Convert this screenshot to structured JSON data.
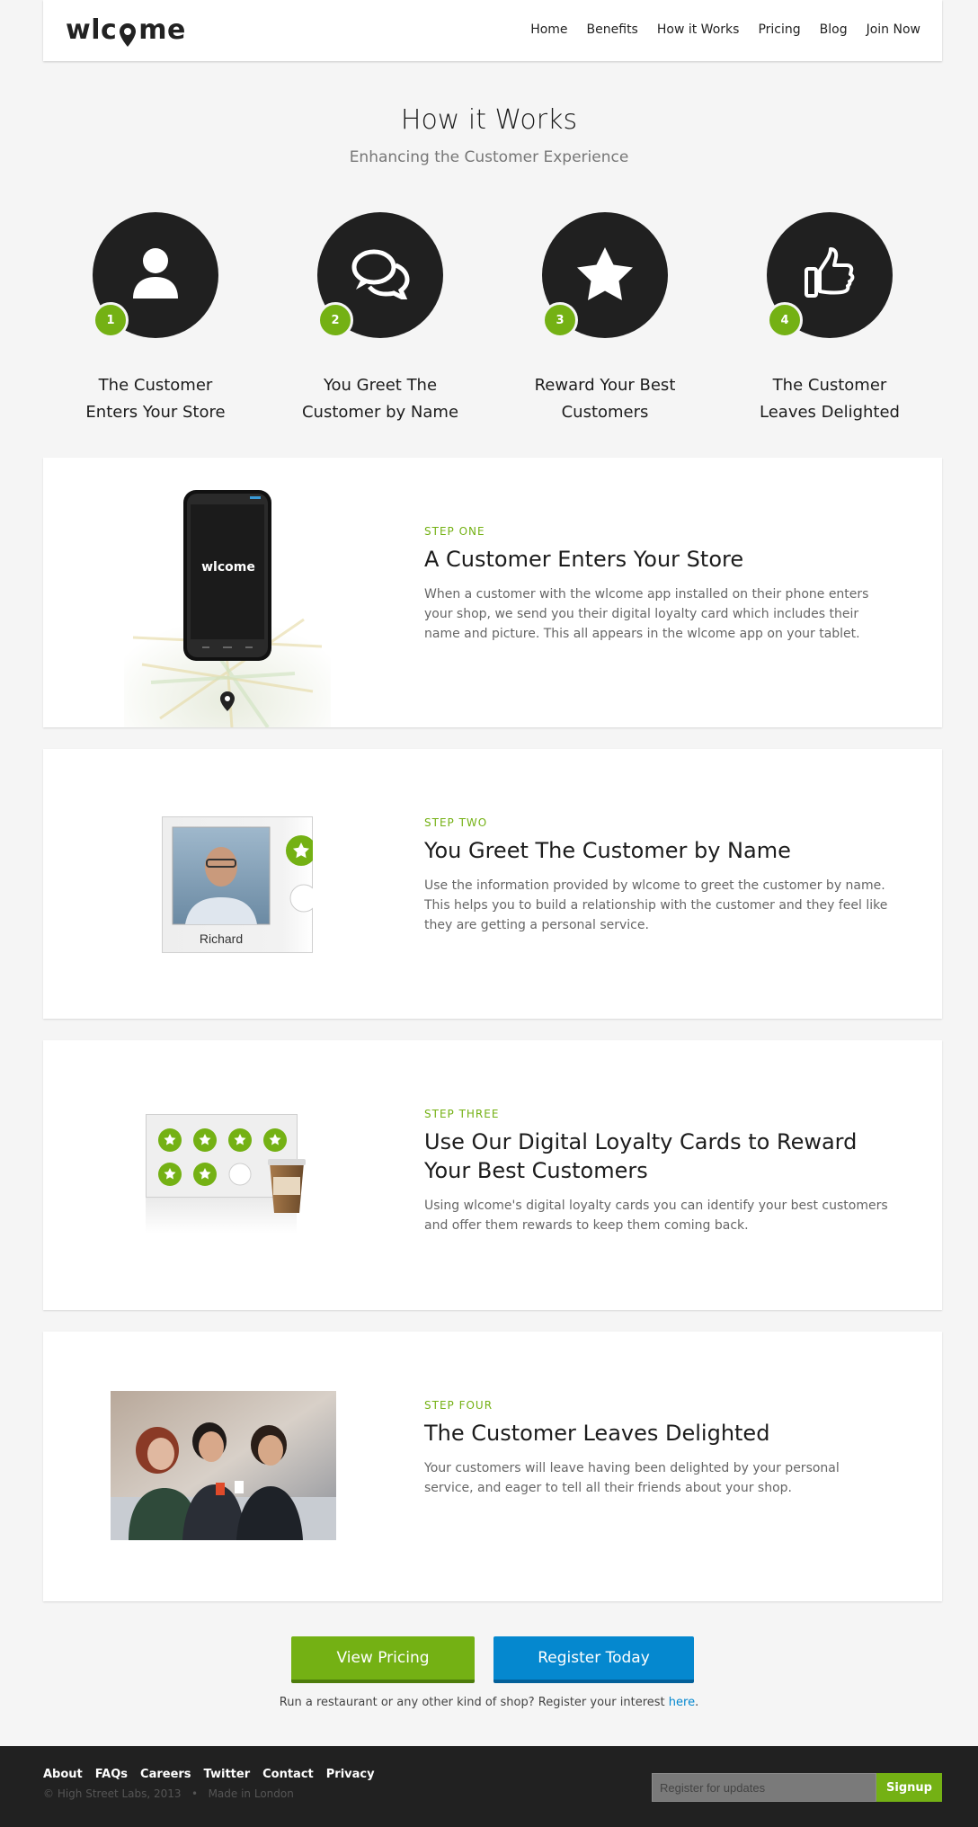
{
  "header": {
    "logo_text_left": "wlc",
    "logo_text_right": "me",
    "nav": [
      "Home",
      "Benefits",
      "How it Works",
      "Pricing",
      "Blog",
      "Join Now"
    ]
  },
  "hero": {
    "title": "How it Works",
    "subtitle": "Enhancing the Customer Experience"
  },
  "steps": [
    {
      "num": "1",
      "label": "The Customer Enters Your Store",
      "icon": "user-icon"
    },
    {
      "num": "2",
      "label": "You Greet The Customer by Name",
      "icon": "chat-bubbles-icon"
    },
    {
      "num": "3",
      "label": "Reward Your Best Customers",
      "icon": "star-icon"
    },
    {
      "num": "4",
      "label": "The Customer Leaves Delighted",
      "icon": "thumbs-up-icon"
    }
  ],
  "cards": [
    {
      "kicker": "STEP ONE",
      "title": "A Customer Enters Your Store",
      "body": "When a customer with the wlcome app installed on their phone enters your shop, we send you their digital loyalty card which includes their name and picture. This all appears in the wlcome app on your tablet.",
      "phone_logo": "wlcome"
    },
    {
      "kicker": "STEP TWO",
      "title": "You Greet The Customer by Name",
      "body": "Use the information provided by wlcome to greet the customer by name. This helps you to build a relationship with the customer and they feel like they are getting a personal service.",
      "profile_name": "Richard"
    },
    {
      "kicker": "STEP THREE",
      "title": "Use Our Digital Loyalty Cards to Reward Your Best Customers",
      "body": "Using wlcome's digital loyalty cards you can identify your best customers and offer them rewards to keep them coming back.",
      "stamps_filled": 6,
      "stamps_total": 8
    },
    {
      "kicker": "STEP FOUR",
      "title": "The Customer Leaves Delighted",
      "body": "Your customers will leave having been delighted by your personal service, and eager to tell all their friends about your shop."
    }
  ],
  "cta": {
    "pricing": "View Pricing",
    "register": "Register Today",
    "note_before": "Run a restaurant or any other kind of shop? Register your interest ",
    "note_link": "here",
    "note_after": "."
  },
  "footer": {
    "links": [
      "About",
      "FAQs",
      "Careers",
      "Twitter",
      "Contact",
      "Privacy"
    ],
    "copyright": "© High Street Labs, 2013",
    "made": "Made in London",
    "input_placeholder": "Register for updates",
    "signup": "Signup"
  },
  "colors": {
    "accent_green": "#74b114",
    "accent_blue": "#0588cf",
    "dark": "#202020"
  }
}
